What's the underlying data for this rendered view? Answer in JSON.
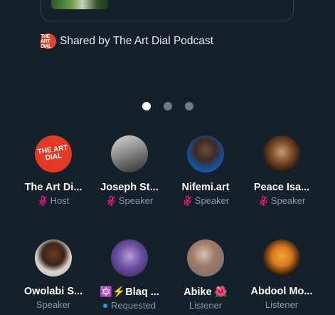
{
  "shared_by": {
    "icon_name": "art-dial-logo-icon",
    "icon_text": "THE ART DIAL",
    "text": "Shared by The Art Dial Podcast"
  },
  "pagination": {
    "total": 3,
    "active": 0
  },
  "participants": [
    {
      "name": "The Art Di...",
      "role": "Host",
      "muted": true,
      "avatar": "artdial",
      "avatar_text": "THE ART DIAL"
    },
    {
      "name": "Joseph St...",
      "role": "Speaker",
      "muted": true,
      "avatar": "joseph"
    },
    {
      "name": "Nifemi.art",
      "role": "Speaker",
      "muted": true,
      "avatar": "nifemi"
    },
    {
      "name": "Peace Isa...",
      "role": "Speaker",
      "muted": true,
      "avatar": "peace"
    },
    {
      "name": "Owolabi S...",
      "role": "Speaker",
      "muted": false,
      "avatar": "owolabi"
    },
    {
      "name": "🔯⚡Blaq ...",
      "role": "Requested",
      "muted": false,
      "requested": true,
      "avatar": "blaq"
    },
    {
      "name": "Abike 🌺",
      "role": "Listener",
      "muted": false,
      "avatar": "abike"
    },
    {
      "name": "Abdool Mo...",
      "role": "Listener",
      "muted": false,
      "avatar": "abdool"
    }
  ],
  "colors": {
    "background": "#15202b",
    "muted_mic": "#f91880",
    "requested_dot": "#1d9bf0",
    "secondary_text": "#8b98a5"
  }
}
